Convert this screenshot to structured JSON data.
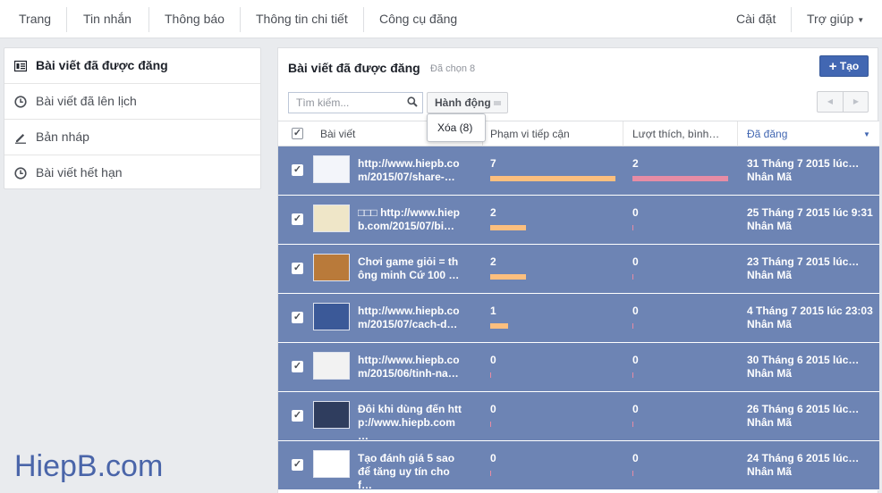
{
  "nav": {
    "items": [
      "Trang",
      "Tin nhắn",
      "Thông báo",
      "Thông tin chi tiết",
      "Công cụ đăng"
    ],
    "settings": "Cài đặt",
    "help": "Trợ giúp"
  },
  "sidebar": {
    "items": [
      {
        "label": "Bài viết đã được đăng",
        "icon": "list-icon"
      },
      {
        "label": "Bài viết đã lên lịch",
        "icon": "clock-icon"
      },
      {
        "label": "Bản nháp",
        "icon": "pencil-icon"
      },
      {
        "label": "Bài viết hết hạn",
        "icon": "clock-icon"
      }
    ]
  },
  "main": {
    "title": "Bài viết đã được đăng",
    "subtitle": "Đã chọn 8",
    "create_label": "Tạo",
    "search_placeholder": "Tìm kiếm...",
    "action_label": "Hành động",
    "popup_label": "Xóa (8)",
    "columns": [
      "Bài viết",
      "Phạm vi tiếp cận",
      "Lượt thích, bình…",
      "Đã đăng"
    ]
  },
  "rows": [
    {
      "text": "http://www.hiepb.co m/2015/07/share-…",
      "reach": "7",
      "reach_value": 7,
      "likes": "2",
      "likes_value": 2,
      "date": "31 Tháng 7 2015 lúc…",
      "author": "Nhân Mã"
    },
    {
      "text": "□□□ http://www.hiep b.com/2015/07/bi…",
      "reach": "2",
      "reach_value": 2,
      "likes": "0",
      "likes_value": 0,
      "date": "25 Tháng 7 2015 lúc 9:31",
      "author": "Nhân Mã"
    },
    {
      "text": "Chơi game giỏi = th ông minh Cứ 100 …",
      "reach": "2",
      "reach_value": 2,
      "likes": "0",
      "likes_value": 0,
      "date": "23 Tháng 7 2015 lúc…",
      "author": "Nhân Mã"
    },
    {
      "text": "http://www.hiepb.co m/2015/07/cach-d…",
      "reach": "1",
      "reach_value": 1,
      "likes": "0",
      "likes_value": 0,
      "date": "4 Tháng 7 2015 lúc 23:03",
      "author": "Nhân Mã"
    },
    {
      "text": "http://www.hiepb.co m/2015/06/tinh-na…",
      "reach": "0",
      "reach_value": 0,
      "likes": "0",
      "likes_value": 0,
      "date": "30 Tháng 6 2015 lúc…",
      "author": "Nhân Mã"
    },
    {
      "text": "Đôi khi dùng đến htt p://www.hiepb.com…",
      "reach": "0",
      "reach_value": 0,
      "likes": "0",
      "likes_value": 0,
      "date": "26 Tháng 6 2015 lúc…",
      "author": "Nhân Mã"
    },
    {
      "text": "Tạo đánh giá 5 sao để tăng uy tín cho f…",
      "reach": "0",
      "reach_value": 0,
      "likes": "0",
      "likes_value": 0,
      "date": "24 Tháng 6 2015 lúc…",
      "author": "Nhân Mã"
    }
  ],
  "watermark": "HiepB.com",
  "colors": {
    "accent": "#4267b2",
    "row_selected": "#6d84b4",
    "reach_bar": "#fcbf7e",
    "likes_bar": "#e68ca5"
  }
}
